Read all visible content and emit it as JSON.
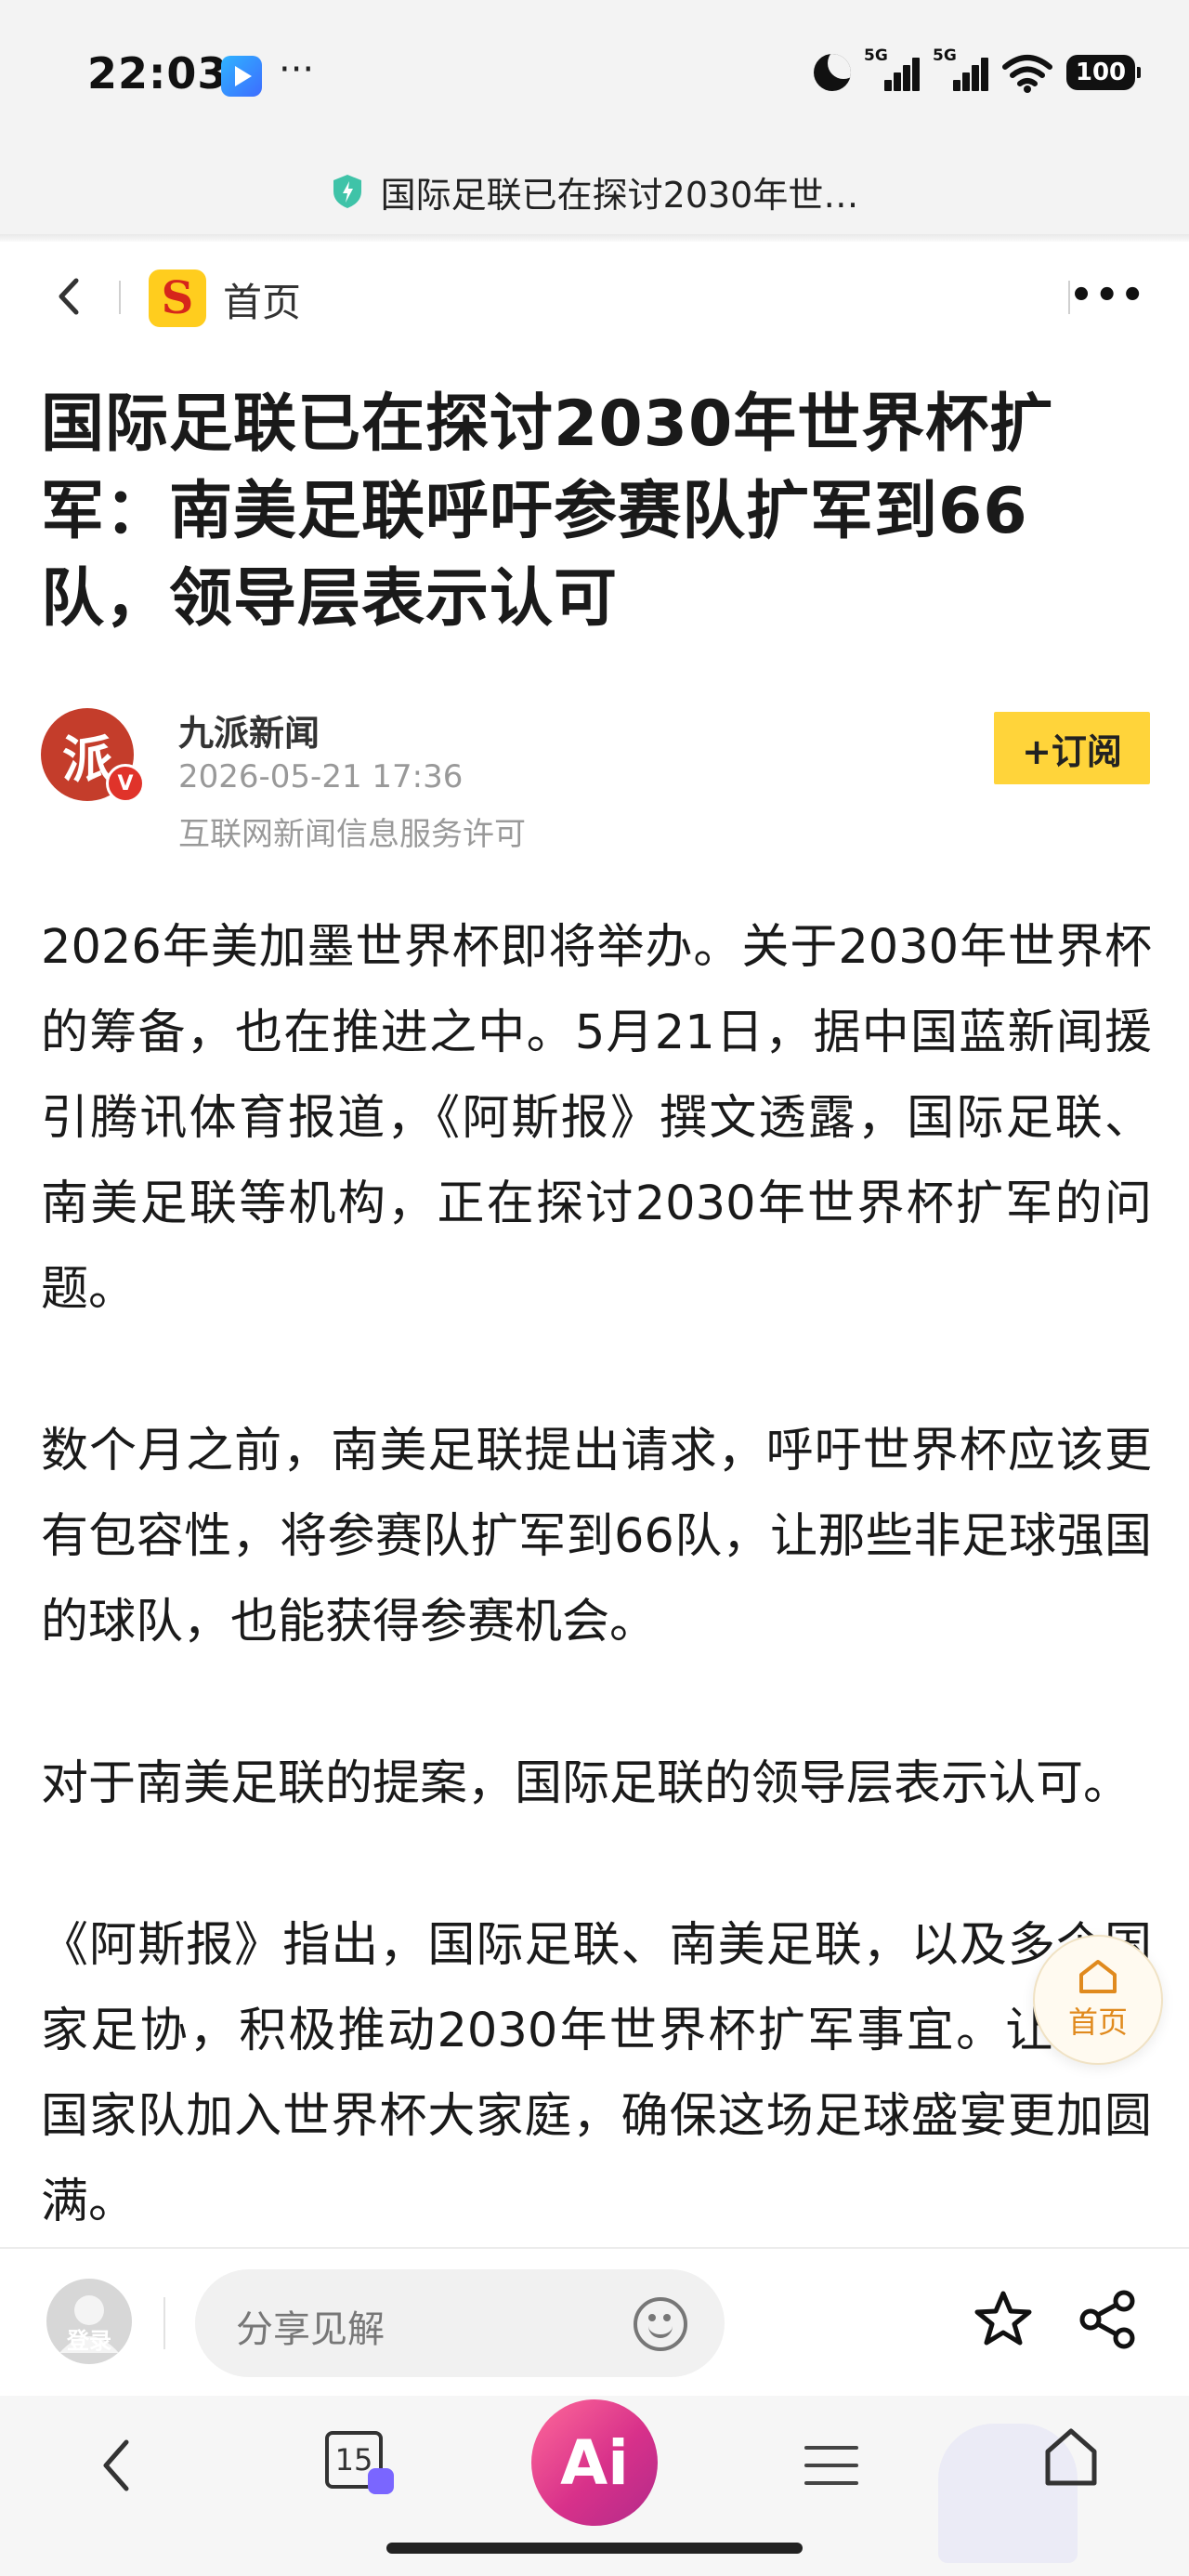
{
  "status_bar": {
    "time": "22:03",
    "dots": "···",
    "signal1_label": "5G",
    "signal2_label": "5G",
    "battery": "100"
  },
  "url_bar": {
    "text": "国际足联已在探讨2030年世…",
    "icon": "shield-check-icon"
  },
  "nav": {
    "home_label": "首页",
    "logo_letter": "S",
    "more": "•••"
  },
  "article": {
    "title": "国际足联已在探讨2030年世界杯扩军：南美足联呼吁参赛队扩军到66队，领导层表示认可",
    "author": {
      "name": "九派新闻",
      "date": "2026-05-21 17:36",
      "license": "互联网新闻信息服务许可",
      "avatar_char": "派",
      "verified_badge": "V"
    },
    "subscribe_label": "+订阅",
    "paragraphs": [
      "2026年美加墨世界杯即将举办。关于2030年世界杯的筹备，也在推进之中。5月21日，据中国蓝新闻援引腾讯体育报道，《阿斯报》撰文透露，国际足联、南美足联等机构，正在探讨2030年世界杯扩军的问题。",
      "数个月之前，南美足联提出请求，呼吁世界杯应该更有包容性，将参赛队扩军到66队，让那些非足球强国的球队，也能获得参赛机会。",
      "对于南美足联的提案，国际足联的领导层表示认可。",
      "《阿斯报》指出，国际足联、南美足联，以及多个国家足协，积极推动2030年世界杯扩军事宜。让更多国家队加入世界杯大家庭，确保这场足球盛宴更加圆满。"
    ]
  },
  "float_home": {
    "label": "首页"
  },
  "action_bar": {
    "login_label": "登录",
    "comment_placeholder": "分享见解"
  },
  "browser_nav": {
    "tab_count": "15",
    "ai_label": "Ai"
  },
  "colors": {
    "accent_yellow": "#ffd43a",
    "brand_red": "#c43d2b",
    "ai_pink": "#d8318a"
  }
}
